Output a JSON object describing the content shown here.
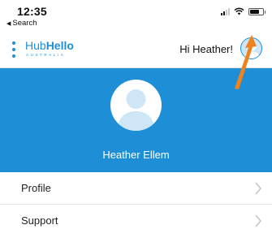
{
  "status_bar": {
    "time": "12:35",
    "back_app": "Search",
    "signal_bars": 4,
    "signal_active": 2,
    "wifi": "wifi-icon",
    "battery_level": 0.7
  },
  "header": {
    "logo_word_regular": "Hub",
    "logo_word_bold": "Hello",
    "logo_sub": "AUSTRALIA",
    "greeting": "Hi Heather!",
    "menu_icon": "kebab-menu-icon",
    "accent_color": "#1e8fd6"
  },
  "banner": {
    "user_name": "Heather Ellem",
    "background_color": "#1e8fd6"
  },
  "menu": {
    "items": [
      {
        "label": "Profile"
      },
      {
        "label": "Support"
      }
    ]
  },
  "annotation": {
    "arrow_color": "#f0821e"
  }
}
